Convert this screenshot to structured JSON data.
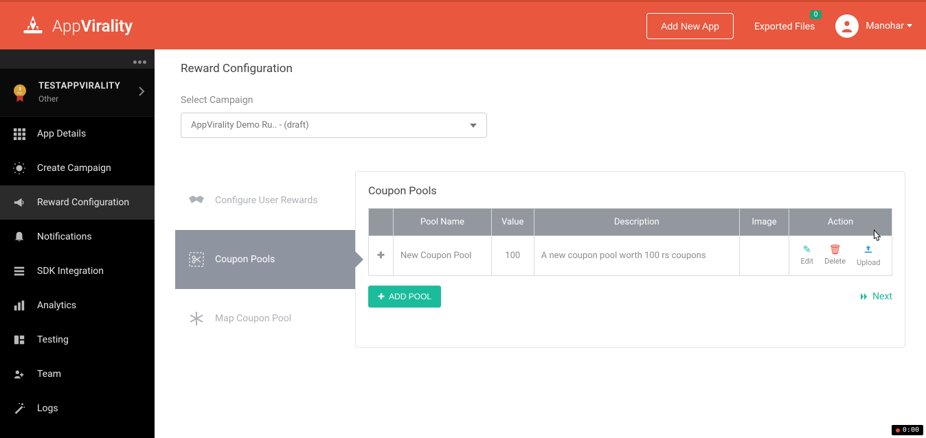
{
  "brand": {
    "name_a": "App",
    "name_b": "Virality"
  },
  "header": {
    "add_app_label": "Add New App",
    "exported_files_label": "Exported Files",
    "exported_files_count": "0",
    "user_name": "Manohar"
  },
  "sidebar": {
    "app_title": "TESTAPPVIRALITY",
    "app_sub": "Other",
    "nav": [
      {
        "label": "App Details"
      },
      {
        "label": "Create Campaign"
      },
      {
        "label": "Reward Configuration"
      },
      {
        "label": "Notifications"
      },
      {
        "label": "SDK Integration"
      },
      {
        "label": "Analytics"
      },
      {
        "label": "Testing"
      },
      {
        "label": "Team"
      },
      {
        "label": "Logs"
      }
    ],
    "active_index": 2
  },
  "main": {
    "page_title": "Reward Configuration",
    "select_label": "Select Campaign",
    "select_value": "AppVirality Demo Ru.. - (draft)",
    "wizard": {
      "configure_label": "Configure User Rewards",
      "coupon_pools_label": "Coupon Pools",
      "map_pool_label": "Map Coupon Pool"
    },
    "panel_title": "Coupon Pools",
    "columns": {
      "name": "Pool Name",
      "value": "Value",
      "desc": "Description",
      "image": "Image",
      "action": "Action"
    },
    "rows": [
      {
        "name": "New Coupon Pool",
        "value": "100",
        "desc": "A new coupon pool worth 100 rs coupons"
      }
    ],
    "actions": {
      "edit": "Edit",
      "delete": "Delete",
      "upload": "Upload"
    },
    "add_pool": "ADD POOL",
    "next": "Next"
  },
  "statusbar": {
    "time": "0:00"
  }
}
